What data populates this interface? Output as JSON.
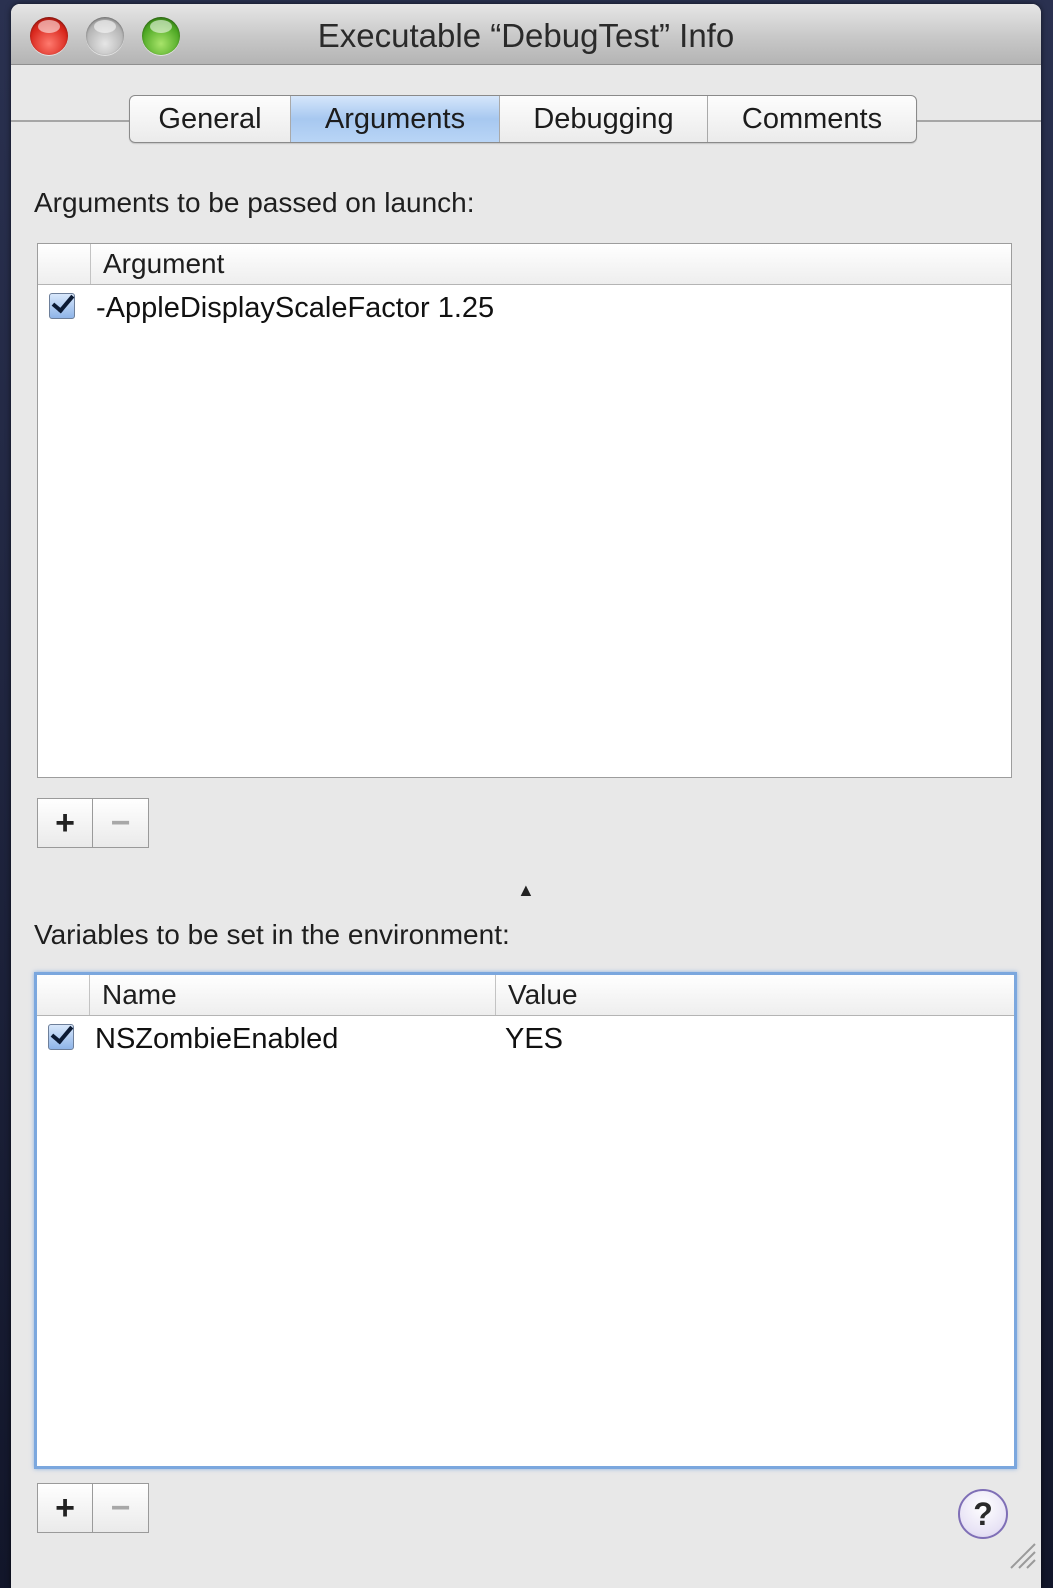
{
  "window": {
    "title": "Executable “DebugTest” Info"
  },
  "tabs": [
    {
      "label": "General",
      "active": false
    },
    {
      "label": "Arguments",
      "active": true
    },
    {
      "label": "Debugging",
      "active": false
    },
    {
      "label": "Comments",
      "active": false
    }
  ],
  "arguments": {
    "section_label": "Arguments to be passed on launch:",
    "column_header": "Argument",
    "rows": [
      {
        "checked": true,
        "argument": "-AppleDisplayScaleFactor 1.25"
      }
    ]
  },
  "environment": {
    "section_label": "Variables to be set in the environment:",
    "columns": {
      "name": "Name",
      "value": "Value"
    },
    "rows": [
      {
        "checked": true,
        "name": "NSZombieEnabled",
        "value": "YES"
      }
    ]
  },
  "buttons": {
    "add": "+",
    "remove": "−",
    "help": "?"
  },
  "colors": {
    "active_tab": "#a7c8f0",
    "focus_ring": "#7ba7de",
    "close": "#d8261c",
    "zoom": "#4ea824"
  },
  "icons": [
    "close-icon",
    "minimize-icon",
    "zoom-icon",
    "checkbox-checked-icon",
    "help-icon",
    "resize-grip-icon"
  ]
}
